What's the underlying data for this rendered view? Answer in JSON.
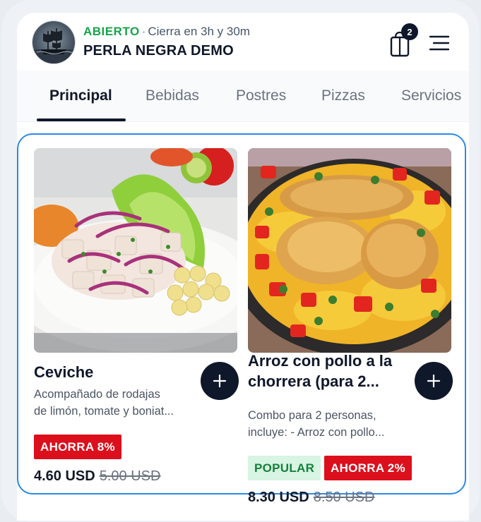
{
  "header": {
    "status": "ABIERTO",
    "separator": "·",
    "closing_info": "Cierra en 3h y 30m",
    "store_name": "PERLA NEGRA DEMO",
    "cart_count": "2"
  },
  "tabs": [
    {
      "label": "Principal",
      "active": true
    },
    {
      "label": "Bebidas",
      "active": false
    },
    {
      "label": "Postres",
      "active": false
    },
    {
      "label": "Pizzas",
      "active": false
    },
    {
      "label": "Servicios",
      "active": false
    }
  ],
  "products": [
    {
      "name": "Ceviche",
      "description": [
        "Acompañado de rodajas",
        "de limón, tomate y boniat..."
      ],
      "badges": [
        "AHORRA 8%"
      ],
      "price": "4.60 USD",
      "old_price": "5.00 USD"
    },
    {
      "name": "Arroz con pollo a la chorrera (para 2...",
      "description": [
        "Combo para 2 personas,",
        "incluye: - Arroz con pollo..."
      ],
      "badges": [
        "POPULAR",
        "AHORRA 2%"
      ],
      "price": "8.30 USD",
      "old_price": "8.50 USD"
    }
  ],
  "icons": {
    "logo": "pirate-ship-logo",
    "cart": "shopping-bag-icon",
    "menu": "hamburger-menu-icon",
    "add": "plus-icon"
  },
  "colors": {
    "open_status": "#16a34a",
    "accent_dark": "#0f172a",
    "save_badge": "#dc0f1c",
    "popular_badge_bg": "#d8f4e2",
    "selection_border": "#2a8ae6"
  }
}
